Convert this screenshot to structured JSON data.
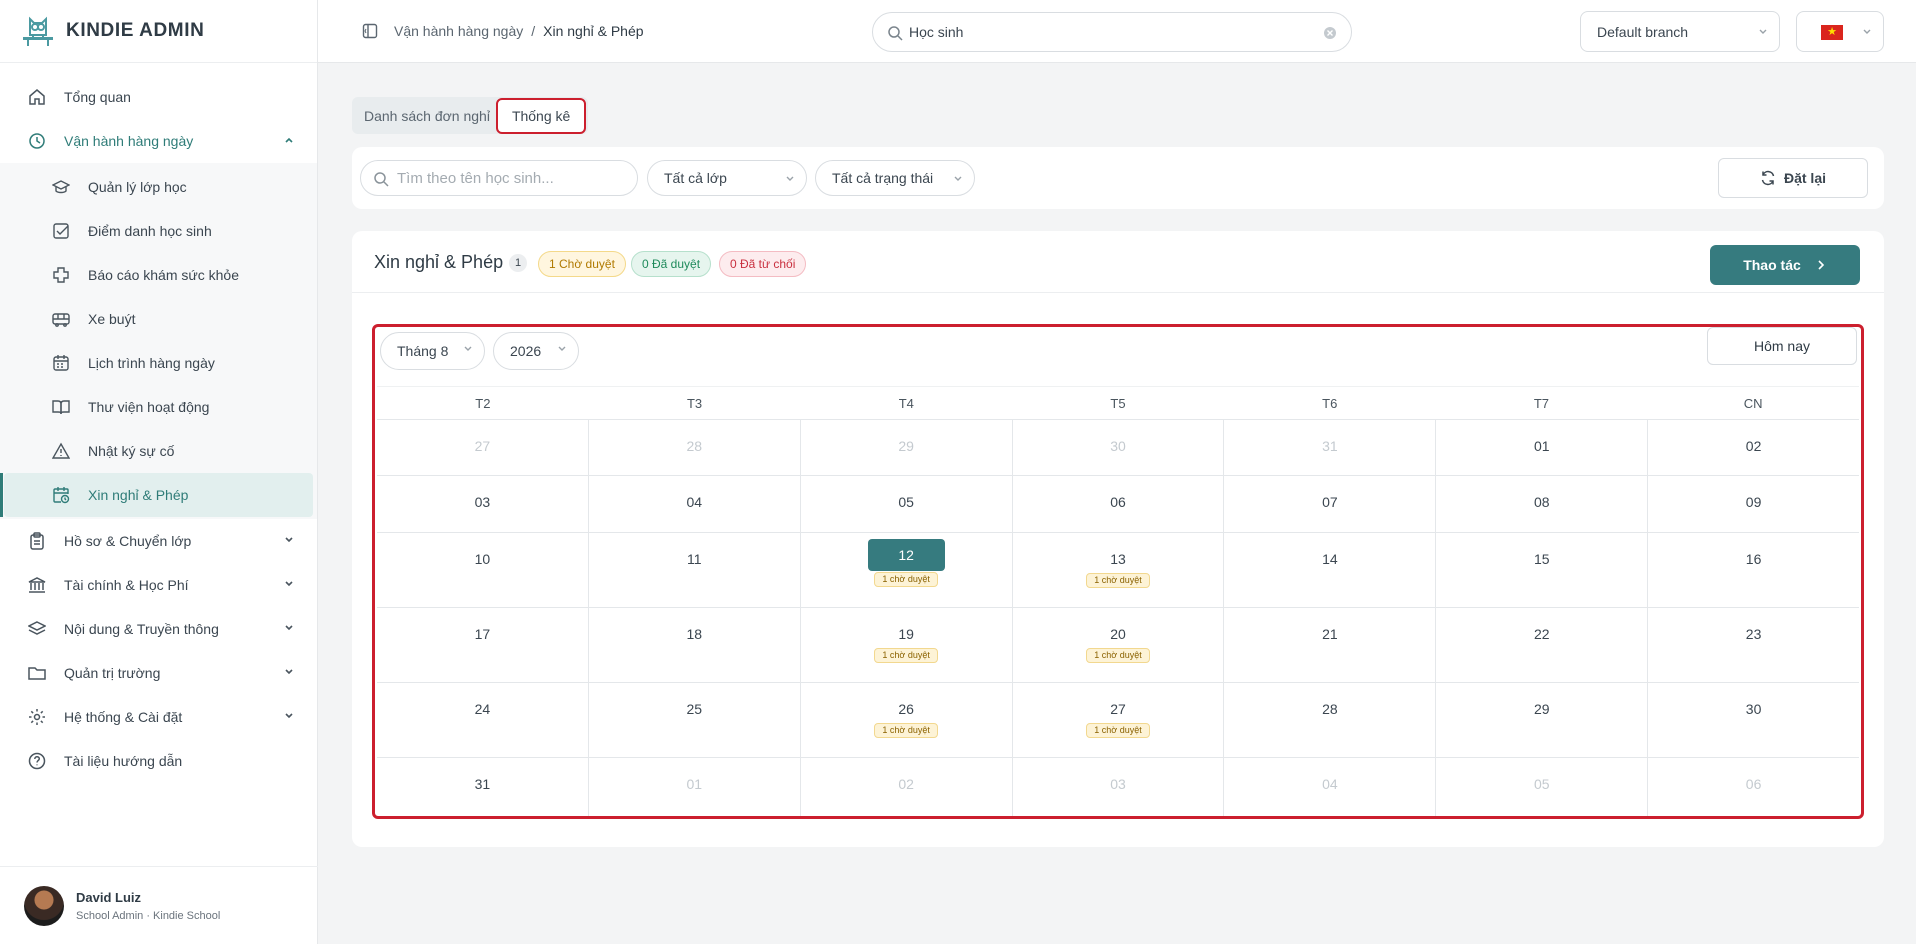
{
  "brand": {
    "name": "KINDIE ADMIN"
  },
  "sidebar": {
    "items": [
      {
        "label": "Tổng quan"
      },
      {
        "label": "Vận hành hàng ngày"
      },
      {
        "label": "Hồ sơ & Chuyển lớp"
      },
      {
        "label": "Tài chính & Học Phí"
      },
      {
        "label": "Nội dung & Truyền thông"
      },
      {
        "label": "Quản trị trường"
      },
      {
        "label": "Hệ thống & Cài đặt"
      },
      {
        "label": "Tài liệu hướng dẫn"
      }
    ],
    "subitems": [
      {
        "label": "Quản lý lớp học"
      },
      {
        "label": "Điểm danh học sinh"
      },
      {
        "label": "Báo cáo khám sức khỏe"
      },
      {
        "label": "Xe buýt"
      },
      {
        "label": "Lịch trình hàng ngày"
      },
      {
        "label": "Thư viện hoạt động"
      },
      {
        "label": "Nhật ký sự cố"
      },
      {
        "label": "Xin nghỉ & Phép"
      }
    ]
  },
  "profile": {
    "name": "David Luiz",
    "role": "School Admin · Kindie School"
  },
  "header": {
    "breadcrumb": [
      "Vận hành hàng ngày",
      "/",
      "Xin nghỉ & Phép"
    ],
    "search_value": "Học sinh",
    "branch": "Default branch"
  },
  "tabs": [
    {
      "label": "Danh sách đơn nghỉ"
    },
    {
      "label": "Thống kê"
    }
  ],
  "filters": {
    "search_placeholder": "Tìm theo tên học sinh...",
    "class_select": "Tất cả lớp",
    "status_select": "Tất cả trạng thái",
    "reset_label": "Đặt lại"
  },
  "card": {
    "title": "Xin nghỉ & Phép",
    "count": "1",
    "pending": "1 Chờ duyệt",
    "approved": "0 Đã duyệt",
    "rejected": "0 Đã từ chối",
    "action_label": "Thao tác"
  },
  "calendar": {
    "month": "Tháng 8",
    "year": "2026",
    "today_label": "Hôm nay",
    "weekdays": [
      "T2",
      "T3",
      "T4",
      "T5",
      "T6",
      "T7",
      "CN"
    ],
    "badge_text": "1 chờ duyệt",
    "weeks": [
      [
        {
          "d": "27",
          "out": true
        },
        {
          "d": "28",
          "out": true
        },
        {
          "d": "29",
          "out": true
        },
        {
          "d": "30",
          "out": true
        },
        {
          "d": "31",
          "out": true
        },
        {
          "d": "01"
        },
        {
          "d": "02"
        }
      ],
      [
        {
          "d": "03"
        },
        {
          "d": "04"
        },
        {
          "d": "05"
        },
        {
          "d": "06"
        },
        {
          "d": "07"
        },
        {
          "d": "08"
        },
        {
          "d": "09"
        }
      ],
      [
        {
          "d": "10"
        },
        {
          "d": "11"
        },
        {
          "d": "12",
          "sel": true,
          "badge": true
        },
        {
          "d": "13",
          "badge": true
        },
        {
          "d": "14"
        },
        {
          "d": "15"
        },
        {
          "d": "16"
        }
      ],
      [
        {
          "d": "17"
        },
        {
          "d": "18"
        },
        {
          "d": "19",
          "badge": true
        },
        {
          "d": "20",
          "badge": true
        },
        {
          "d": "21"
        },
        {
          "d": "22"
        },
        {
          "d": "23"
        }
      ],
      [
        {
          "d": "24"
        },
        {
          "d": "25"
        },
        {
          "d": "26",
          "badge": true
        },
        {
          "d": "27",
          "badge": true
        },
        {
          "d": "28"
        },
        {
          "d": "29"
        },
        {
          "d": "30"
        }
      ],
      [
        {
          "d": "31"
        },
        {
          "d": "01",
          "out": true
        },
        {
          "d": "02",
          "out": true
        },
        {
          "d": "03",
          "out": true
        },
        {
          "d": "04",
          "out": true
        },
        {
          "d": "05",
          "out": true
        },
        {
          "d": "06",
          "out": true
        }
      ]
    ]
  },
  "colors": {
    "accent": "#367b7f",
    "highlight": "#cc1f2e"
  }
}
